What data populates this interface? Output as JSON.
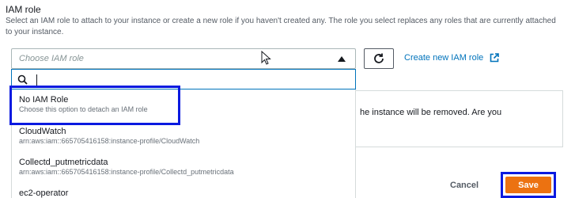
{
  "section": {
    "title": "IAM role",
    "description": "Select an IAM role to attach to your instance or create a new role if you haven't created any. The role you select replaces any roles that are currently attached to your instance."
  },
  "select": {
    "placeholder": "Choose IAM role"
  },
  "refresh_icon": "refresh-icon",
  "create_link": {
    "label": "Create new IAM role",
    "icon": "external-link-icon"
  },
  "search": {
    "value": ""
  },
  "options": [
    {
      "label": "No IAM Role",
      "sub": "Choose this option to detach an IAM role"
    },
    {
      "label": "CloudWatch",
      "sub": "arn:aws:iam::665705416158:instance-profile/CloudWatch"
    },
    {
      "label": "Collectd_putmetricdata",
      "sub": "arn:aws:iam::665705416158:instance-profile/Collectd_putmetricdata"
    },
    {
      "label": "ec2-operator",
      "sub": ""
    }
  ],
  "warning": {
    "line1": "he instance will be removed. Are you",
    "line2": ""
  },
  "buttons": {
    "cancel": "Cancel",
    "save": "Save"
  },
  "colors": {
    "accent": "#0073bb",
    "save_bg": "#ec7211",
    "highlight": "#0a1ae0"
  }
}
